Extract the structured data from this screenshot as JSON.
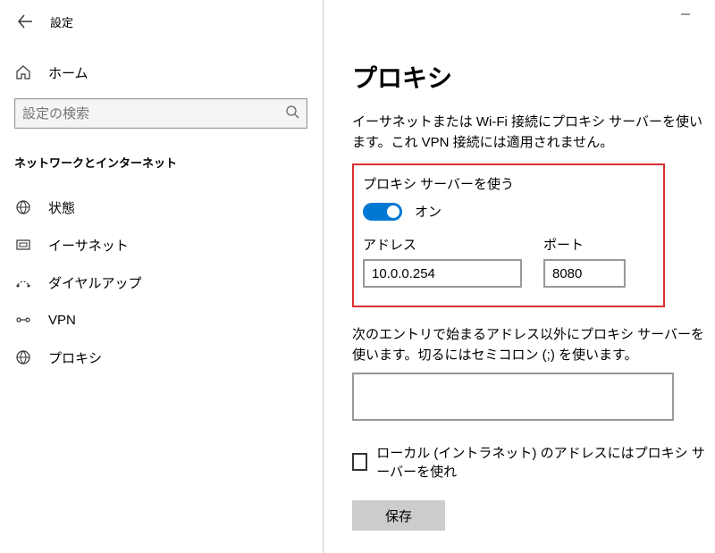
{
  "header": {
    "title": "設定"
  },
  "sidebar": {
    "home_label": "ホーム",
    "search_placeholder": "設定の検索",
    "category_title": "ネットワークとインターネット",
    "items": [
      {
        "label": "状態"
      },
      {
        "label": "イーサネット"
      },
      {
        "label": "ダイヤルアップ"
      },
      {
        "label": "VPN"
      },
      {
        "label": "プロキシ"
      }
    ]
  },
  "content": {
    "page_title": "プロキシ",
    "description": "イーサネットまたは Wi-Fi 接続にプロキシ サーバーを使います。これ VPN 接続には適用されません。",
    "use_proxy_label": "プロキシ サーバーを使う",
    "toggle_state": "オン",
    "address_label": "アドレス",
    "address_value": "10.0.0.254",
    "port_label": "ポート",
    "port_value": "8080",
    "exclude_desc": "次のエントリで始まるアドレス以外にプロキシ サーバーを使います。切るにはセミコロン (;) を使います。",
    "exclude_value": "",
    "local_checkbox_label": "ローカル (イントラネット) のアドレスにはプロキシ サーバーを使れ",
    "save_label": "保存"
  }
}
